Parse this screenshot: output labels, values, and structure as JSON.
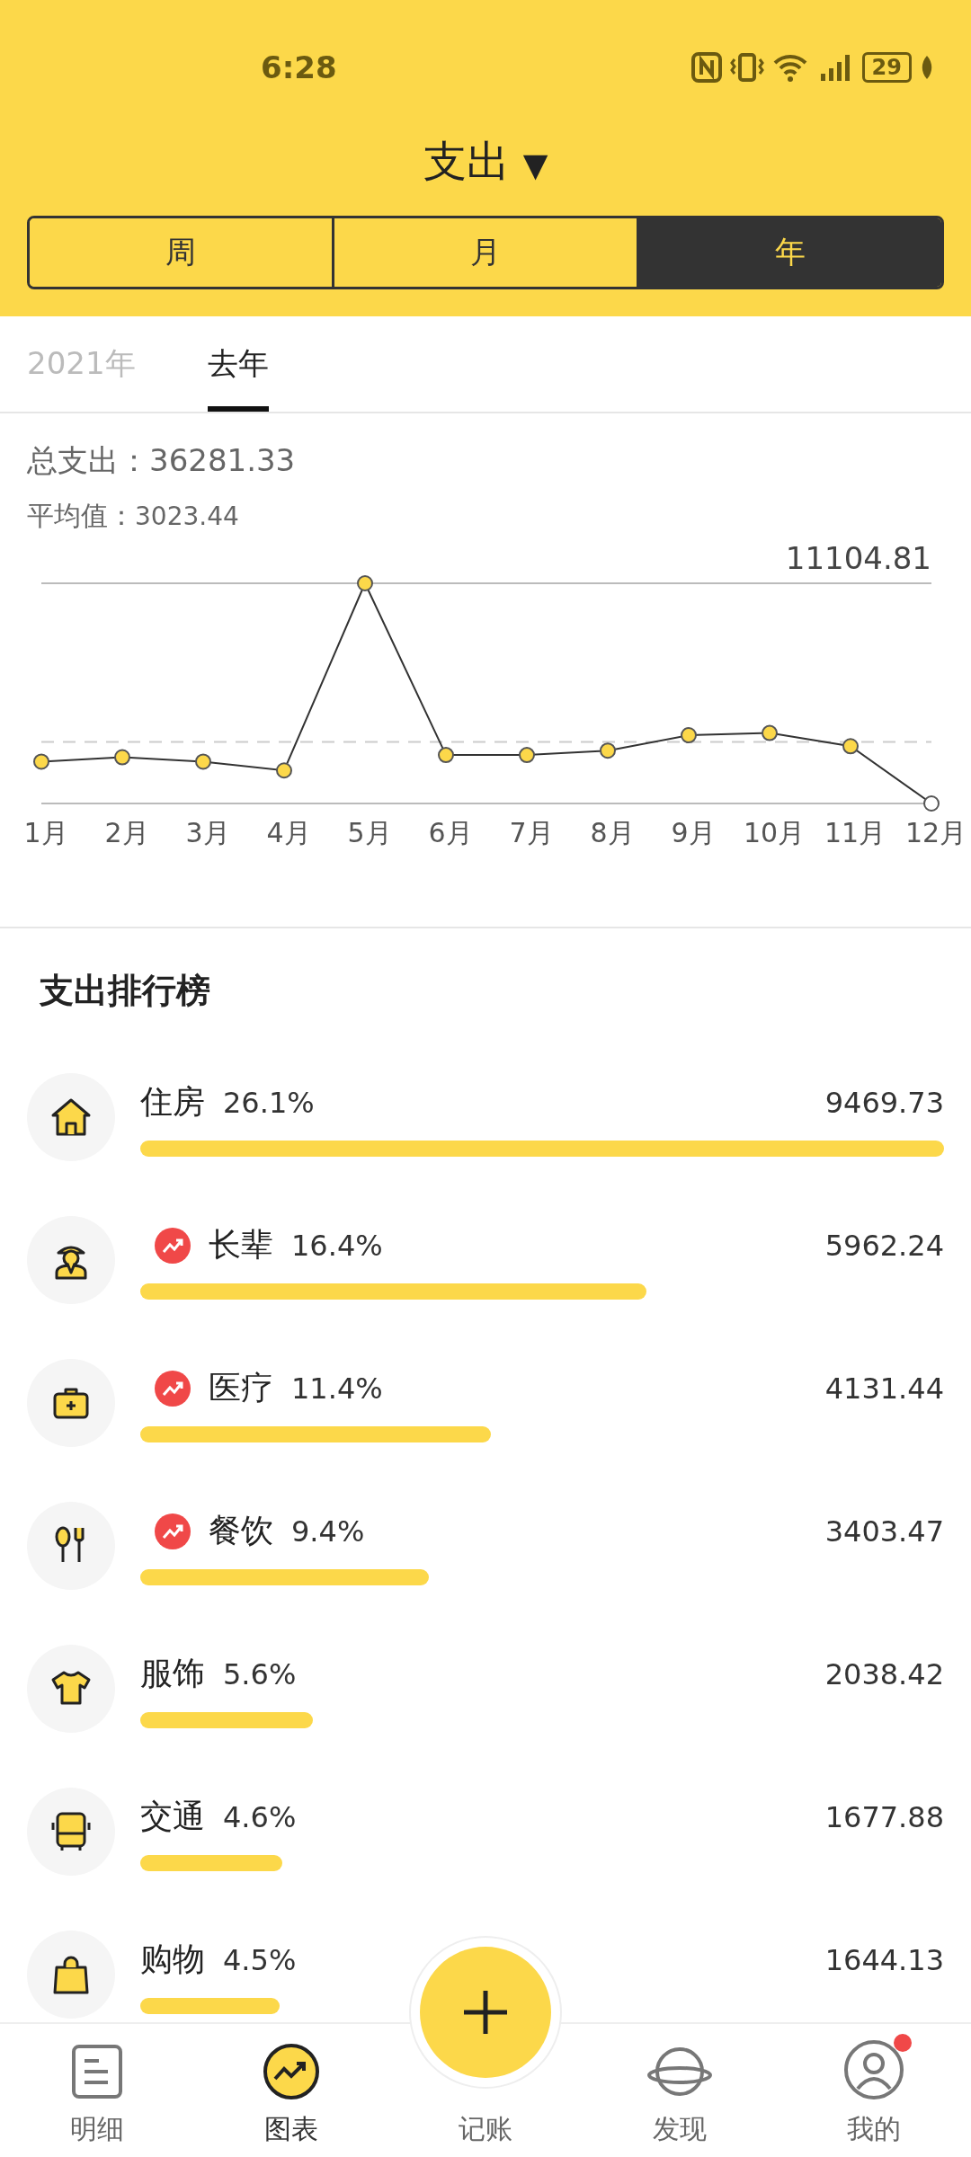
{
  "status_bar": {
    "time": "6:28",
    "battery": "29"
  },
  "header": {
    "title": "支出",
    "caret": "▼"
  },
  "period_tabs": [
    {
      "label": "周",
      "selected": false
    },
    {
      "label": "月",
      "selected": false
    },
    {
      "label": "年",
      "selected": true
    }
  ],
  "year_tabs": [
    {
      "label": "2021年",
      "selected": false
    },
    {
      "label": "去年",
      "selected": true
    }
  ],
  "summary": {
    "total_label": "总支出：",
    "total": "36281.33",
    "average_label": "平均值：",
    "average": "3023.44"
  },
  "chart": {
    "max_label": "11104.81",
    "months": [
      "1月",
      "2月",
      "3月",
      "4月",
      "5月",
      "6月",
      "7月",
      "8月",
      "9月",
      "10月",
      "11月",
      "12月"
    ]
  },
  "ranking": {
    "title": "支出排行榜",
    "items": [
      {
        "kind": "house",
        "name": "住房",
        "percent": "26.1%",
        "amount": "9469.73",
        "trend": false
      },
      {
        "kind": "elder",
        "name": "长辈",
        "percent": "16.4%",
        "amount": "5962.24",
        "trend": true
      },
      {
        "kind": "medkit",
        "name": "医疗",
        "percent": "11.4%",
        "amount": "4131.44",
        "trend": true
      },
      {
        "kind": "food",
        "name": "餐饮",
        "percent": "9.4%",
        "amount": "3403.47",
        "trend": true
      },
      {
        "kind": "shirt",
        "name": "服饰",
        "percent": "5.6%",
        "amount": "2038.42",
        "trend": false
      },
      {
        "kind": "bus",
        "name": "交通",
        "percent": "4.6%",
        "amount": "1677.88",
        "trend": false
      },
      {
        "kind": "bag",
        "name": "购物",
        "percent": "4.5%",
        "amount": "1644.13",
        "trend": false
      }
    ]
  },
  "bottom_nav": [
    {
      "kind": "list",
      "label": "明细",
      "selected": false,
      "badge": false
    },
    {
      "kind": "chart",
      "label": "图表",
      "selected": true,
      "badge": false
    },
    {
      "kind": "add",
      "label": "记账",
      "selected": false,
      "badge": false
    },
    {
      "kind": "planet",
      "label": "发现",
      "selected": false,
      "badge": false
    },
    {
      "kind": "user",
      "label": "我的",
      "selected": false,
      "badge": true
    }
  ]
}
